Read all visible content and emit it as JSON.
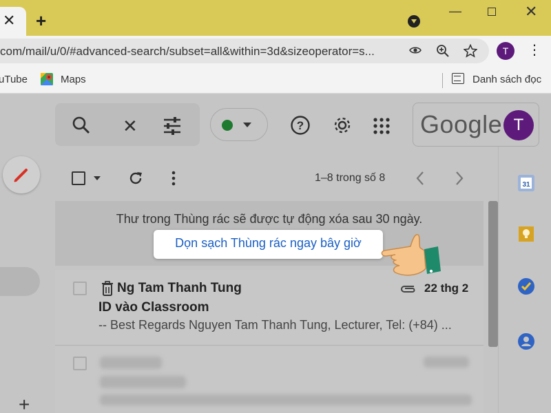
{
  "browser": {
    "tab_close": "✕",
    "new_tab": "+",
    "url": "com/mail/u/0/#advanced-search/subset=all&within=3d&sizeoperator=s...",
    "profile_initial": "T",
    "menu": "⋮",
    "window": {
      "minimize": "—",
      "close": "✕"
    },
    "toolbar_icons": {
      "lens": "lens-icon",
      "zoom": "zoom-icon",
      "star": "star-icon"
    }
  },
  "bookmarks": {
    "youtube": "uTube",
    "maps": "Maps",
    "reading_list": "Danh sách đọc"
  },
  "gmail": {
    "header": {
      "search_icon": "search-icon",
      "clear_icon": "✕",
      "filter_icon": "tune-icon",
      "status_color": "#1e7a2f",
      "help": "?",
      "google_logo": "Google",
      "account_initial": "T"
    },
    "list_toolbar": {
      "pager": "1–8 trong số 8",
      "prev": "‹",
      "next": "›"
    },
    "trash_banner": {
      "notice": "Thư trong Thùng rác sẽ được tự động xóa sau 30 ngày.",
      "empty_button": "Dọn sạch Thùng rác ngay bây giờ"
    },
    "emails": [
      {
        "sender": "Ng Tam Thanh Tung",
        "subject": "ID vào Classroom",
        "snippet": "-- Best Regards Nguyen Tam Thanh Tung, Lecturer, Tel: (+84) ...",
        "date": "22 thg 2",
        "has_attachment": true
      }
    ],
    "side_apps": [
      "calendar-icon",
      "keep-icon",
      "tasks-icon",
      "contacts-icon"
    ],
    "accent": "#1a5fc4"
  }
}
